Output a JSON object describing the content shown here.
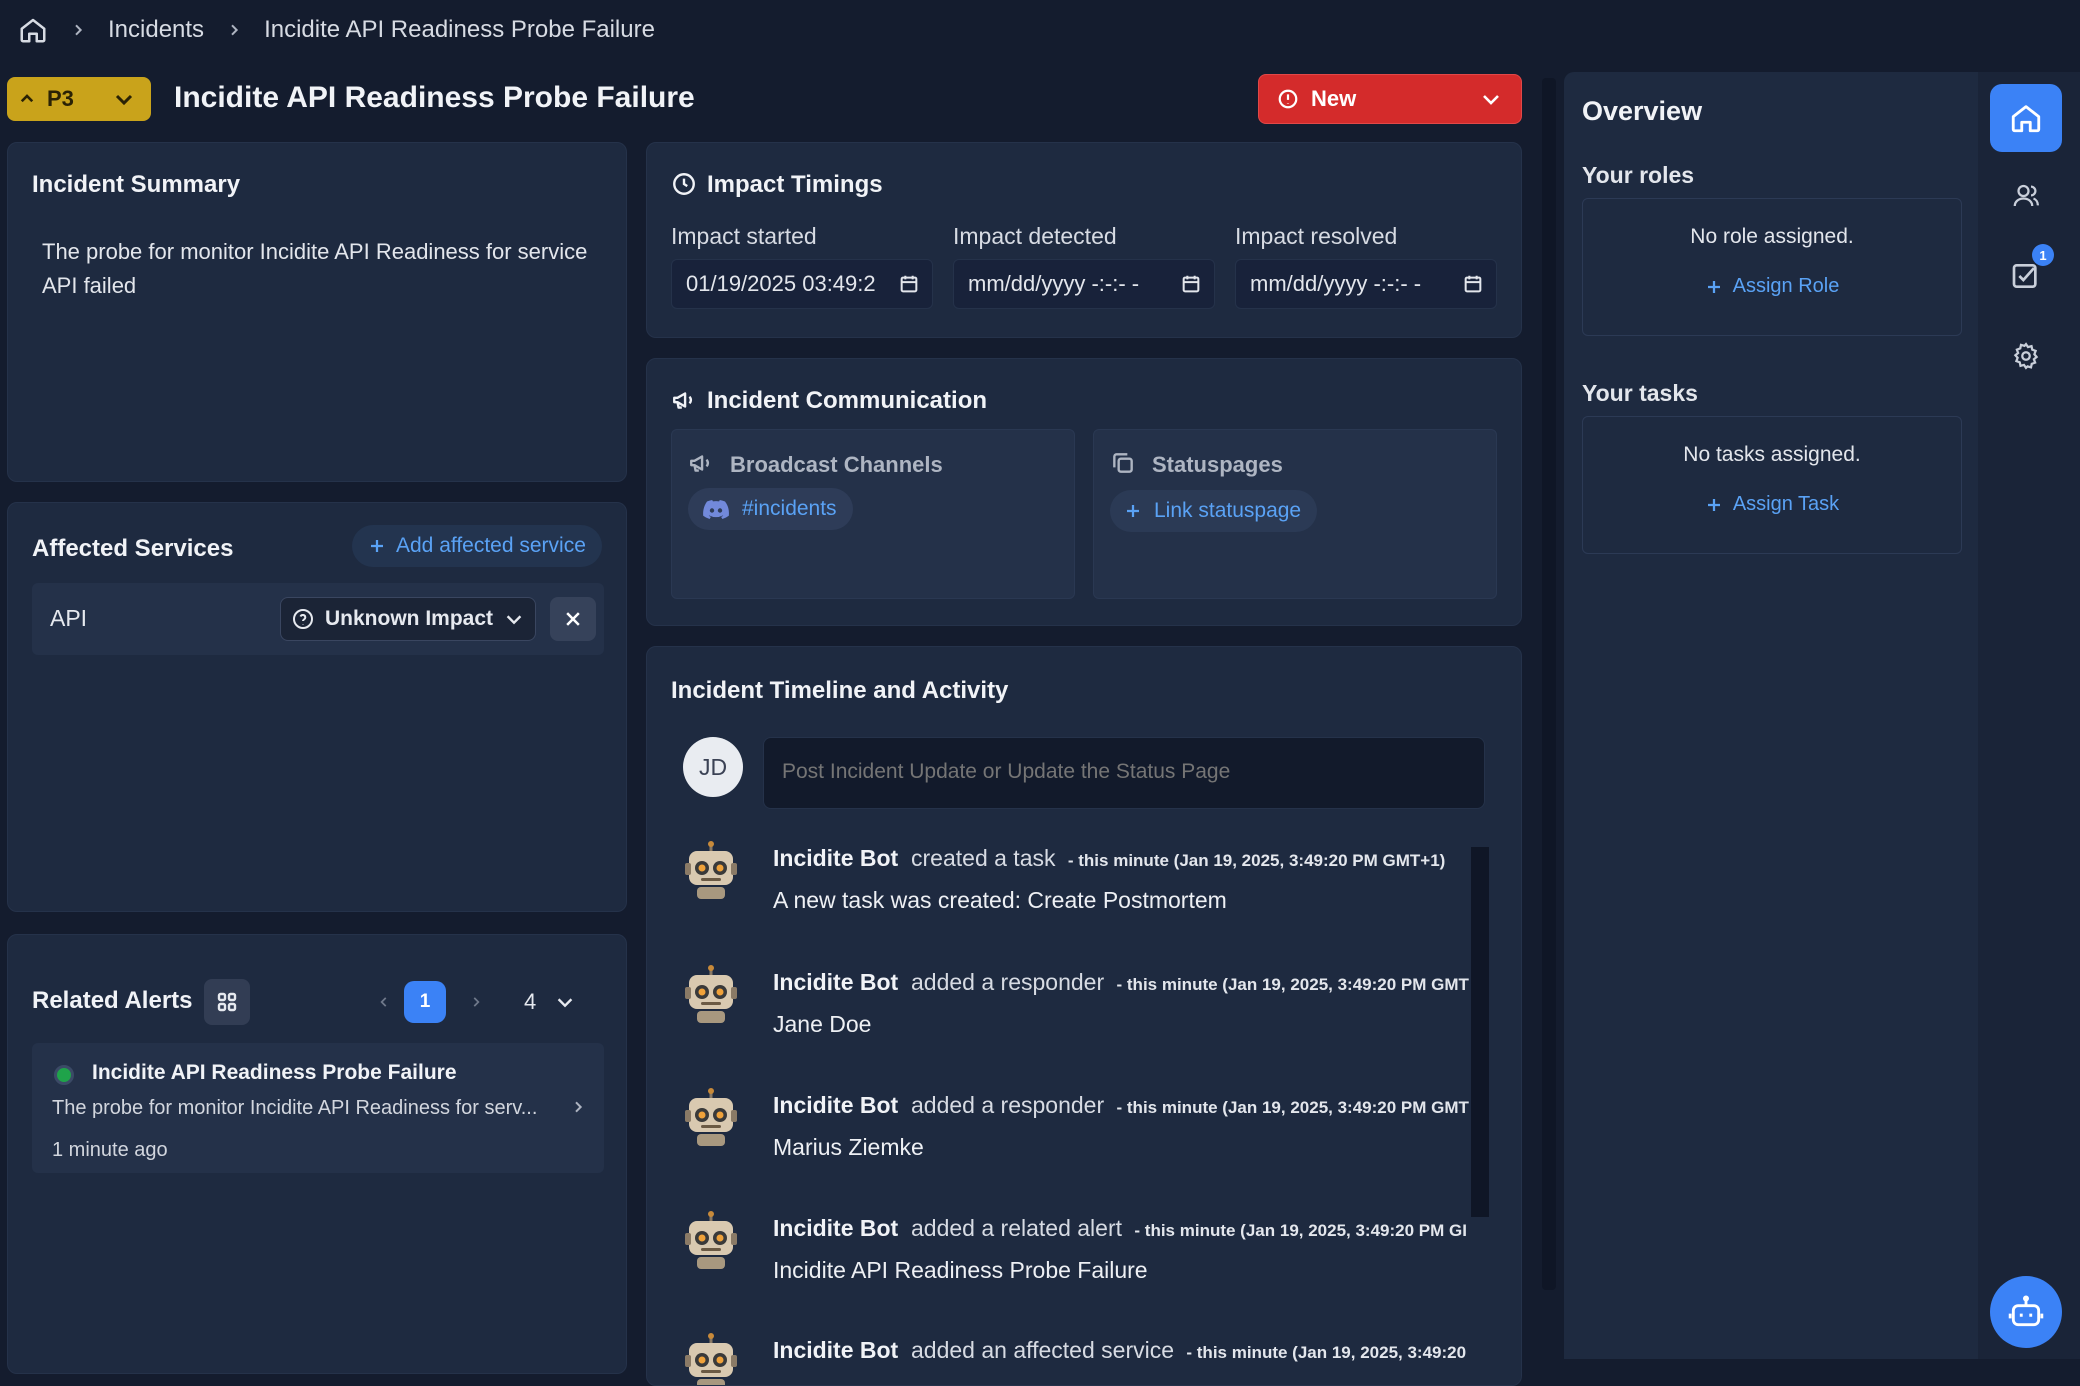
{
  "breadcrumb": {
    "items": [
      "Incidents",
      "Incidite API Readiness Probe Failure"
    ]
  },
  "header": {
    "priority": "P3",
    "title": "Incidite API Readiness Probe Failure",
    "state": "New"
  },
  "summary": {
    "title": "Incident Summary",
    "text": "The probe for monitor Incidite API Readiness for service API failed"
  },
  "affected_services": {
    "title": "Affected Services",
    "add_label": "Add affected service",
    "items": [
      {
        "name": "API",
        "impact": "Unknown Impact"
      }
    ]
  },
  "related_alerts": {
    "title": "Related Alerts",
    "current_page": "1",
    "page_size": "4",
    "items": [
      {
        "title": "Incidite API Readiness Probe Failure",
        "description": "The probe for monitor Incidite API Readiness for serv...",
        "time": "1 minute ago",
        "status_color": "#1fa34a"
      }
    ]
  },
  "impact_timings": {
    "title": "Impact Timings",
    "started_label": "Impact started",
    "started_value": "01/19/2025 03:49:2",
    "detected_label": "Impact detected",
    "detected_value": "mm/dd/yyyy -:-:- -",
    "resolved_label": "Impact resolved",
    "resolved_value": "mm/dd/yyyy -:-:- -"
  },
  "communication": {
    "title": "Incident Communication",
    "broadcast_title": "Broadcast Channels",
    "channel": "#incidents",
    "statuspages_title": "Statuspages",
    "link_statuspage": "Link statuspage"
  },
  "timeline": {
    "title": "Incident Timeline and Activity",
    "avatar_initials": "JD",
    "post_placeholder": "Post Incident Update or Update the Status Page",
    "entries": [
      {
        "actor": "Incidite Bot",
        "action": "created a task",
        "timestamp": "- this minute (Jan 19, 2025, 3:49:20 PM GMT+1)",
        "body": "A new task was created: Create Postmortem"
      },
      {
        "actor": "Incidite Bot",
        "action": "added a responder",
        "timestamp": "- this minute (Jan 19, 2025, 3:49:20 PM GMT",
        "body": "Jane Doe"
      },
      {
        "actor": "Incidite Bot",
        "action": "added a responder",
        "timestamp": "- this minute (Jan 19, 2025, 3:49:20 PM GMT",
        "body": "Marius Ziemke"
      },
      {
        "actor": "Incidite Bot",
        "action": "added a related alert",
        "timestamp": "- this minute (Jan 19, 2025, 3:49:20 PM GI",
        "body": "Incidite API Readiness Probe Failure"
      },
      {
        "actor": "Incidite Bot",
        "action": "added an affected service",
        "timestamp": "- this minute (Jan 19, 2025, 3:49:20",
        "body": ""
      }
    ]
  },
  "overview": {
    "title": "Overview",
    "roles_title": "Your roles",
    "roles_empty": "No role assigned.",
    "assign_role": "Assign Role",
    "tasks_title": "Your tasks",
    "tasks_empty": "No tasks assigned.",
    "assign_task": "Assign Task"
  },
  "rail": {
    "tasks_badge": "1"
  },
  "icons": [
    "home-icon",
    "chevron-right-icon",
    "chevron-up-icon",
    "chevron-down-icon",
    "alert-circle-icon",
    "clock-icon",
    "megaphone-icon",
    "discord-icon",
    "copy-icon",
    "plus-icon",
    "help-circle-icon",
    "close-icon",
    "grid-icon",
    "users-icon",
    "check-square-icon",
    "gear-icon",
    "bot-icon",
    "calendar-icon"
  ]
}
